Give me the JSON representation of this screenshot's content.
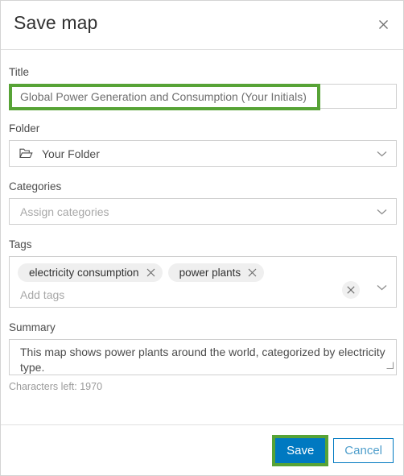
{
  "dialog": {
    "title": "Save map",
    "close_icon": "close-icon"
  },
  "fields": {
    "title": {
      "label": "Title",
      "value": "Global Power Generation and Consumption (Your Initials)"
    },
    "folder": {
      "label": "Folder",
      "value": "Your Folder",
      "icon": "folder-icon",
      "chevron": "chevron-down-icon"
    },
    "categories": {
      "label": "Categories",
      "placeholder": "Assign categories",
      "chevron": "chevron-down-icon"
    },
    "tags": {
      "label": "Tags",
      "chips": [
        {
          "label": "electricity consumption",
          "remove_icon": "close-icon"
        },
        {
          "label": "power plants",
          "remove_icon": "close-icon"
        }
      ],
      "placeholder": "Add tags",
      "clear_icon": "close-icon",
      "chevron": "chevron-down-icon"
    },
    "summary": {
      "label": "Summary",
      "value": "This map shows power plants around the world, categorized by electricity type.",
      "characters_left": "Characters left: 1970",
      "resize_icon": "resize-handle-icon"
    }
  },
  "footer": {
    "save_label": "Save",
    "cancel_label": "Cancel"
  },
  "colors": {
    "primary_blue": "#0079c1",
    "highlight_green": "#57a336",
    "chip_bg": "#efefef",
    "border_grey": "#cfcfcf",
    "text_dark": "#323232",
    "text_muted": "#a8a8a8"
  }
}
